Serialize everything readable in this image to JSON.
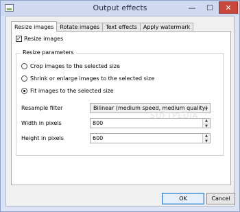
{
  "window": {
    "title": "Output effects"
  },
  "tabs": [
    {
      "label": "Resize images",
      "active": true
    },
    {
      "label": "Rotate images",
      "active": false
    },
    {
      "label": "Text effects",
      "active": false
    },
    {
      "label": "Apply watermark",
      "active": false
    }
  ],
  "resize": {
    "enable_label": "Resize images",
    "enabled": true,
    "group_title": "Resize parameters",
    "modes": [
      {
        "label": "Crop images to the selected size",
        "checked": false
      },
      {
        "label": "Shrink or enlarge images to the selected size",
        "checked": false
      },
      {
        "label": "Fit images to the selected size",
        "checked": true
      }
    ],
    "filter_label": "Resample filter",
    "filter_value": "Bilinear (medium speed, medium quality)",
    "width_label": "Width in pixels",
    "width_value": "800",
    "height_label": "Height in pixels",
    "height_value": "600"
  },
  "watermark_text": "SOFTPEDIA",
  "buttons": {
    "ok": "OK",
    "cancel": "Cancel"
  }
}
